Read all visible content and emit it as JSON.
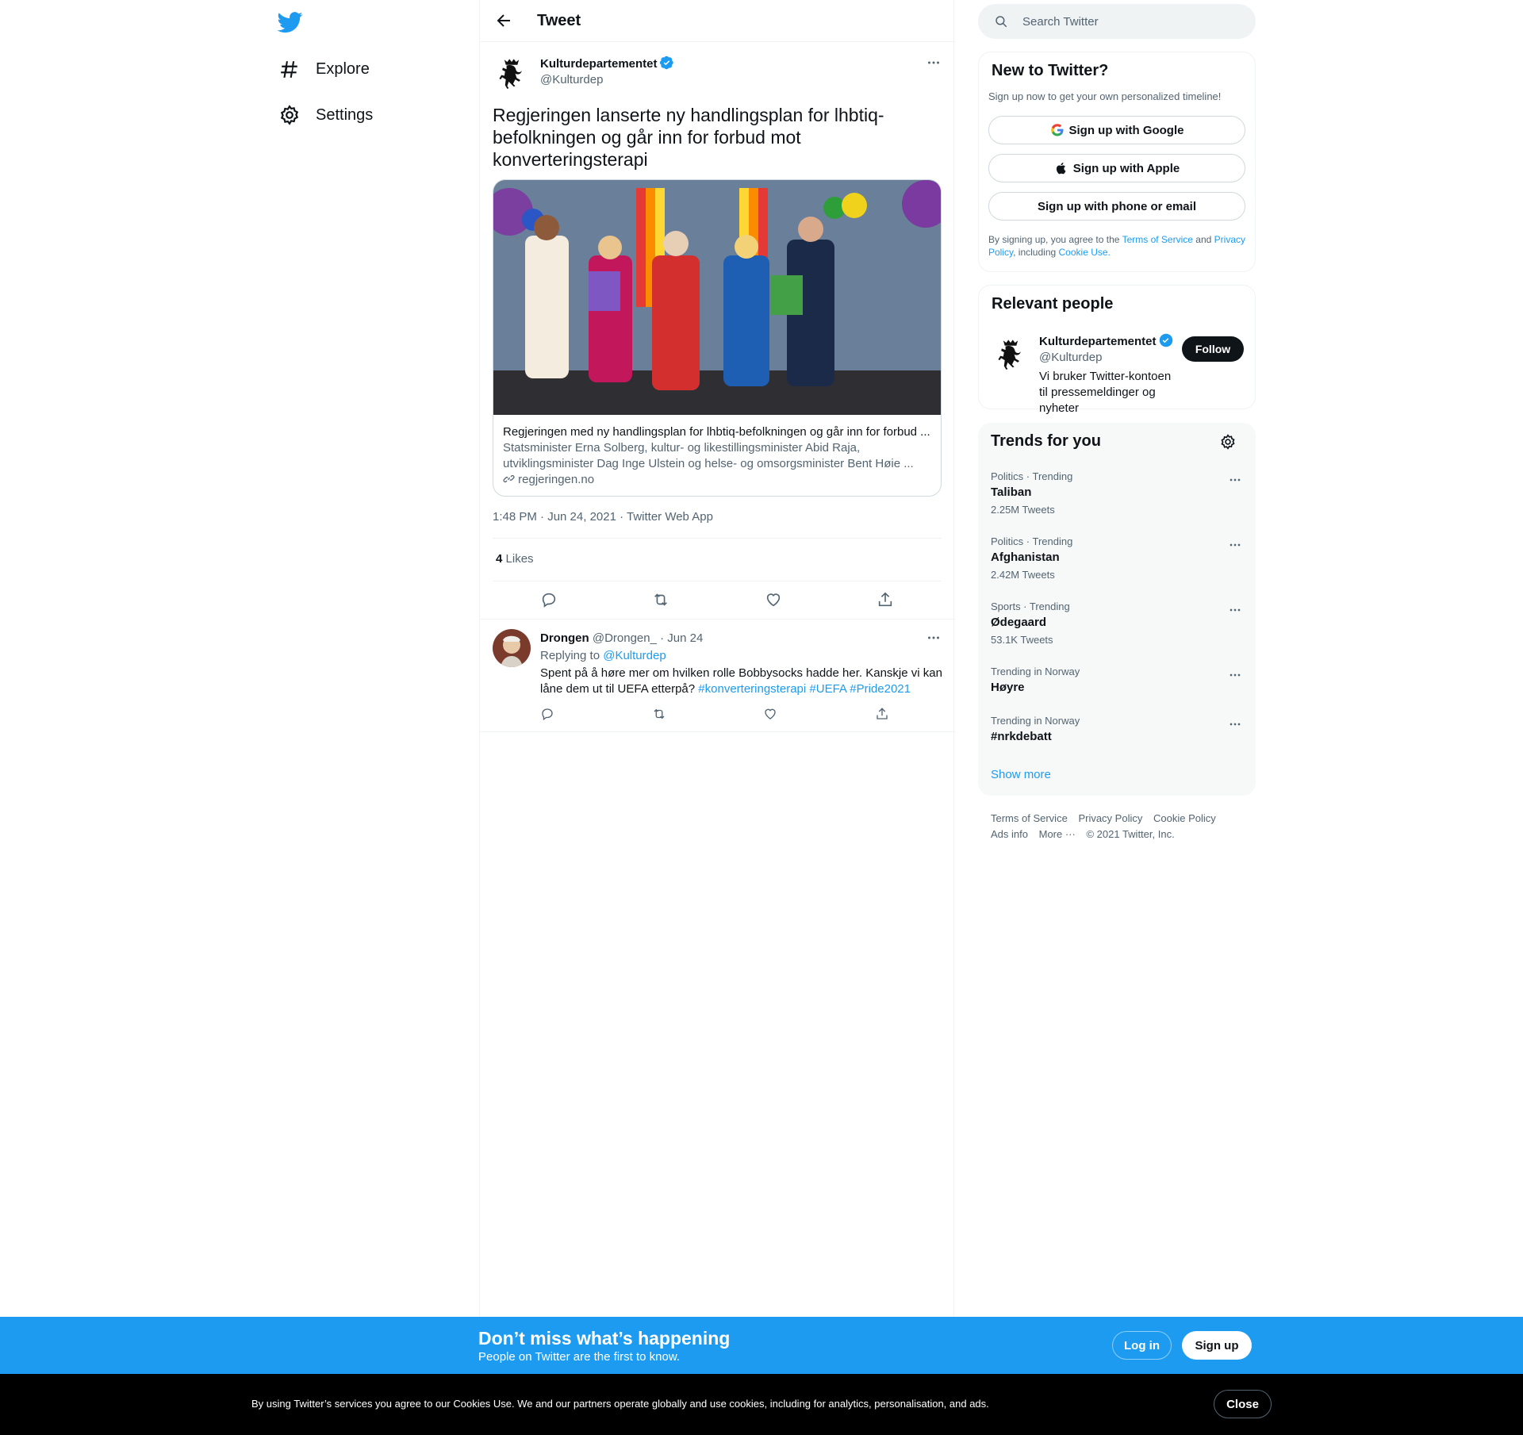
{
  "nav": {
    "items": [
      {
        "label": "Explore",
        "icon": "hash-icon"
      },
      {
        "label": "Settings",
        "icon": "gear-icon"
      }
    ]
  },
  "header": {
    "title": "Tweet"
  },
  "tweet": {
    "author_name": "Kulturdepartementet",
    "author_handle": "@Kulturdep",
    "text": "Regjeringen lanserte ny handlingsplan for lhbtiq-befolkningen og går inn for forbud mot konverteringsterapi",
    "card": {
      "title": "Regjeringen med ny handlingsplan for lhbtiq-befolkningen og går inn for forbud ...",
      "description": "Statsminister Erna Solberg, kultur- og likestillingsminister Abid Raja, utviklingsminister Dag Inge Ulstein og helse- og omsorgsminister Bent Høie ...",
      "domain": "regjeringen.no"
    },
    "timestamp": "1:48 PM · Jun 24, 2021 · Twitter Web App",
    "likes_count": "4",
    "likes_label": "Likes"
  },
  "reply": {
    "author_name": "Drongen",
    "author_handle": "@Drongen_",
    "date": "· Jun 24",
    "replying_prefix": "Replying to",
    "replying_to": "@Kulturdep",
    "text": "Spent på å høre mer om hvilken rolle Bobbysocks hadde her. Kanskje vi kan låne dem ut til UEFA etterpå?",
    "hashtags": [
      "#konverteringsterapi",
      "#UEFA",
      "#Pride2021"
    ]
  },
  "search": {
    "placeholder": "Search Twitter"
  },
  "signup": {
    "title": "New to Twitter?",
    "subtitle": "Sign up now to get your own personalized timeline!",
    "google": "Sign up with Google",
    "apple": "Sign up with Apple",
    "phone": "Sign up with phone or email",
    "legal_1": "By signing up, you agree to the",
    "terms": "Terms of Service",
    "legal_2": "and",
    "privacy": "Privacy Policy",
    "legal_3": ", including",
    "cookie": "Cookie Use."
  },
  "relevant": {
    "title": "Relevant people",
    "name": "Kulturdepartementet",
    "handle": "@Kulturdep",
    "follow": "Follow",
    "bio": "Vi bruker Twitter-kontoen til pressemeldinger og nyheter"
  },
  "trends": {
    "title": "Trends for you",
    "items": [
      {
        "meta": "Politics · Trending",
        "name": "Taliban",
        "count": "2.25M Tweets"
      },
      {
        "meta": "Politics · Trending",
        "name": "Afghanistan",
        "count": "2.42M Tweets"
      },
      {
        "meta": "Sports · Trending",
        "name": "Ødegaard",
        "count": "53.1K Tweets"
      },
      {
        "meta": "Trending in Norway",
        "name": "Høyre",
        "count": ""
      },
      {
        "meta": "Trending in Norway",
        "name": "#nrkdebatt",
        "count": ""
      }
    ],
    "show_more": "Show more"
  },
  "footer": {
    "terms": "Terms of Service",
    "privacy": "Privacy Policy",
    "cookie": "Cookie Policy",
    "ads": "Ads info",
    "more": "More ···",
    "copyright": "© 2021 Twitter, Inc."
  },
  "banner": {
    "title": "Don’t miss what’s happening",
    "subtitle": "People on Twitter are the first to know.",
    "login": "Log in",
    "signup": "Sign up"
  },
  "cookie_bar": {
    "text": "By using Twitter’s services you agree to our Cookies Use. We and our partners operate globally and use cookies, including for analytics, personalisation, and ads.",
    "close": "Close"
  },
  "colors": {
    "accent": "#1d9bf0",
    "text": "#0f1419",
    "muted": "#536471"
  }
}
